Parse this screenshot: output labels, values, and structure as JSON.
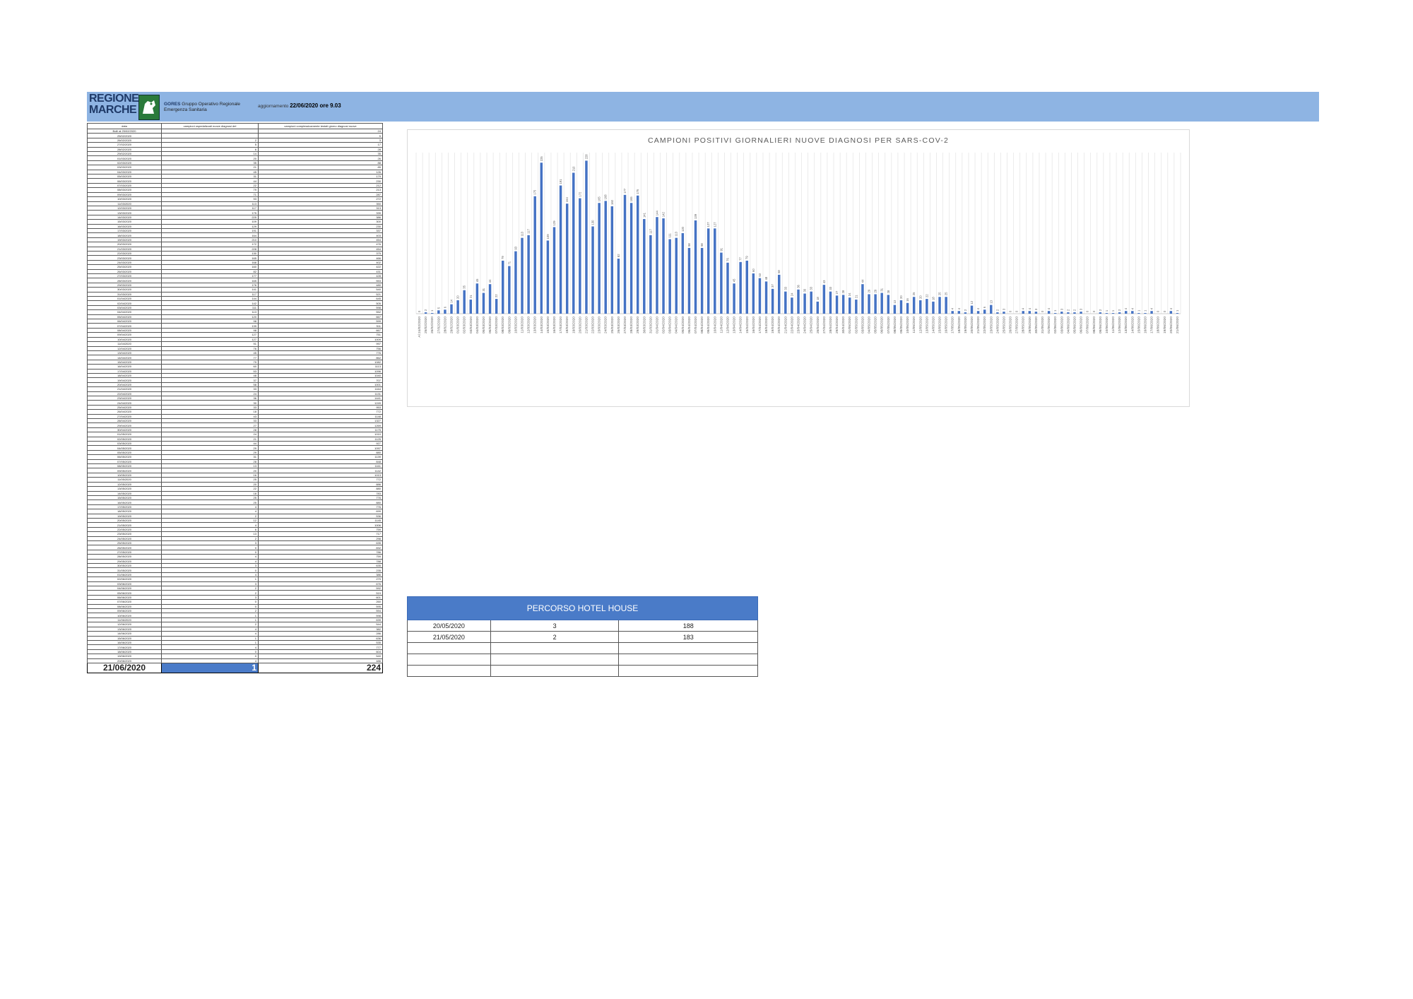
{
  "header": {
    "logo_text_1": "REGIONE",
    "logo_text_2": "MARCHE",
    "gores_title": "GORES",
    "gores_line1": "Gruppo Operativo Regionale",
    "gores_line2": "Emergenza Sanitaria",
    "update_label": "aggiornamento",
    "update_value": "22/06/2020 ore 9.03",
    "band_color": "#8eb4e3"
  },
  "table": {
    "headers": [
      "data",
      "campioni ospedalizzati nuove diagnosi del",
      "campioni complessivamente testati giorno diagnosi nuove"
    ],
    "rows": [
      [
        "Bolli al 25/02/2020",
        "",
        "24"
      ],
      [
        "25/02/2020",
        "",
        "5"
      ],
      [
        "26/02/2020",
        "2",
        "3"
      ],
      [
        "27/02/2020",
        "5",
        "17"
      ],
      [
        "28/02/2020",
        "6",
        "28"
      ],
      [
        "29/02/2020",
        "14",
        "35"
      ],
      [
        "01/03/2020",
        "20",
        "26"
      ],
      [
        "02/03/2020",
        "35",
        "88"
      ],
      [
        "03/03/2020",
        "21",
        "85"
      ],
      [
        "04/03/2020",
        "45",
        "126"
      ],
      [
        "05/03/2020",
        "31",
        "179"
      ],
      [
        "06/03/2020",
        "44",
        "230"
      ],
      [
        "07/03/2020",
        "22",
        "212"
      ],
      [
        "08/03/2020",
        "79",
        "213"
      ],
      [
        "09/03/2020",
        "71",
        "287"
      ],
      [
        "10/03/2020",
        "93",
        "272"
      ],
      [
        "11/03/2020",
        "113",
        "350"
      ],
      [
        "12/03/2020",
        "117",
        "313"
      ],
      [
        "13/03/2020",
        "175",
        "339"
      ],
      [
        "14/03/2020",
        "225",
        "386"
      ],
      [
        "15/03/2020",
        "109",
        "300"
      ],
      [
        "16/03/2020",
        "129",
        "230"
      ],
      [
        "17/03/2020",
        "191",
        "337"
      ],
      [
        "18/03/2020",
        "164",
        "403"
      ],
      [
        "19/03/2020",
        "210",
        "454"
      ],
      [
        "20/03/2020",
        "172",
        "476"
      ],
      [
        "21/03/2020",
        "228",
        "454"
      ],
      [
        "22/03/2020",
        "130",
        "375"
      ],
      [
        "23/03/2020",
        "165",
        "466"
      ],
      [
        "24/03/2020",
        "168",
        "402"
      ],
      [
        "25/03/2020",
        "160",
        "422"
      ],
      [
        "26/03/2020",
        "82",
        "431"
      ],
      [
        "27/03/2020",
        "177",
        "428"
      ],
      [
        "28/03/2020",
        "165",
        "553"
      ],
      [
        "29/03/2020",
        "176",
        "480"
      ],
      [
        "30/03/2020",
        "141",
        "540"
      ],
      [
        "31/03/2020",
        "117",
        "521"
      ],
      [
        "01/04/2020",
        "144",
        "645"
      ],
      [
        "02/04/2020",
        "142",
        "505"
      ],
      [
        "03/04/2020",
        "111",
        "598"
      ],
      [
        "04/04/2020",
        "113",
        "552"
      ],
      [
        "05/04/2020",
        "120",
        "667"
      ],
      [
        "06/04/2020",
        "98",
        "599"
      ],
      [
        "07/04/2020",
        "139",
        "511"
      ],
      [
        "08/04/2020",
        "98",
        "667"
      ],
      [
        "09/04/2020",
        "127",
        "751"
      ],
      [
        "10/04/2020",
        "127",
        "1009"
      ],
      [
        "11/04/2020",
        "91",
        "997"
      ],
      [
        "12/04/2020",
        "76",
        "756"
      ],
      [
        "13/04/2020",
        "45",
        "776"
      ],
      [
        "14/04/2020",
        "77",
        "862"
      ],
      [
        "15/04/2020",
        "79",
        "1082"
      ],
      [
        "16/04/2020",
        "60",
        "1113"
      ],
      [
        "17/04/2020",
        "53",
        "1096"
      ],
      [
        "18/04/2020",
        "48",
        "1040"
      ],
      [
        "19/04/2020",
        "37",
        "707"
      ],
      [
        "20/04/2020",
        "58",
        "1001"
      ],
      [
        "21/04/2020",
        "33",
        "1164"
      ],
      [
        "22/04/2020",
        "24",
        "1131"
      ],
      [
        "23/04/2020",
        "36",
        "1441"
      ],
      [
        "24/04/2020",
        "30",
        "1249"
      ],
      [
        "25/04/2020",
        "33",
        "953"
      ],
      [
        "26/04/2020",
        "18",
        "772"
      ],
      [
        "27/04/2020",
        "43",
        "1148"
      ],
      [
        "28/04/2020",
        "33",
        "1327"
      ],
      [
        "29/04/2020",
        "27",
        "1269"
      ],
      [
        "30/04/2020",
        "28",
        "1175"
      ],
      [
        "01/05/2020",
        "24",
        "1010"
      ],
      [
        "02/05/2020",
        "21",
        "1125"
      ],
      [
        "03/05/2020",
        "44",
        "927"
      ],
      [
        "04/05/2020",
        "29",
        "1097"
      ],
      [
        "05/05/2020",
        "29",
        "880"
      ],
      [
        "06/05/2020",
        "31",
        "1139"
      ],
      [
        "07/05/2020",
        "28",
        "848"
      ],
      [
        "08/05/2020",
        "13",
        "1161"
      ],
      [
        "09/05/2020",
        "20",
        "1142"
      ],
      [
        "10/05/2020",
        "16",
        "1013"
      ],
      [
        "11/05/2020",
        "25",
        "772"
      ],
      [
        "12/05/2020",
        "20",
        "886"
      ],
      [
        "13/05/2020",
        "22",
        "880"
      ],
      [
        "14/05/2020",
        "18",
        "783"
      ],
      [
        "15/05/2020",
        "25",
        "776"
      ],
      [
        "16/05/2020",
        "25",
        "880"
      ],
      [
        "17/05/2020",
        "4",
        "776"
      ],
      [
        "18/05/2020",
        "4",
        "699"
      ],
      [
        "19/05/2020",
        "2",
        "536"
      ],
      [
        "20/05/2020",
        "12",
        "1145"
      ],
      [
        "21/05/2020",
        "4",
        "1006"
      ],
      [
        "22/05/2020",
        "6",
        "759"
      ],
      [
        "23/05/2020",
        "13",
        "717"
      ],
      [
        "24/05/2020",
        "2",
        "298"
      ],
      [
        "25/05/2020",
        "3",
        "635"
      ],
      [
        "26/05/2020",
        "0",
        "832"
      ],
      [
        "27/05/2020",
        "0",
        "786"
      ],
      [
        "28/05/2020",
        "4",
        "759"
      ],
      [
        "29/05/2020",
        "4",
        "788"
      ],
      [
        "30/05/2020",
        "3",
        "635"
      ],
      [
        "31/05/2020",
        "0",
        "235"
      ],
      [
        "01/06/2020",
        "4",
        "386"
      ],
      [
        "02/06/2020",
        "1",
        "279"
      ],
      [
        "03/06/2020",
        "3",
        "676"
      ],
      [
        "04/06/2020",
        "2",
        "592"
      ],
      [
        "05/06/2020",
        "2",
        "519"
      ],
      [
        "06/06/2020",
        "3",
        "601"
      ],
      [
        "07/06/2020",
        "0",
        "260"
      ],
      [
        "08/06/2020",
        "0",
        "595"
      ],
      [
        "09/06/2020",
        "2",
        "594"
      ],
      [
        "10/06/2020",
        "1",
        "598"
      ],
      [
        "11/06/2020",
        "1",
        "639"
      ],
      [
        "12/06/2020",
        "2",
        "544"
      ],
      [
        "13/06/2020",
        "4",
        "382"
      ],
      [
        "14/06/2020",
        "4",
        "286"
      ],
      [
        "15/06/2020",
        "1",
        "636"
      ],
      [
        "16/06/2020",
        "1",
        "535"
      ],
      [
        "17/06/2020",
        "4",
        "777"
      ],
      [
        "18/06/2020",
        "0",
        "604"
      ],
      [
        "19/06/2020",
        "0",
        "540"
      ],
      [
        "20/06/2020",
        "4",
        "486"
      ]
    ],
    "total": {
      "date": "21/06/2020",
      "v1": "1",
      "v2": "224"
    }
  },
  "chart_data": {
    "type": "bar",
    "title": "CAMPIONI POSITIVI GIORNALIERI NUOVE DIAGNOSI PER SARS-COV-2",
    "xlabel": "",
    "ylabel": "",
    "grid": "vertical",
    "bar_color": "#4472c4",
    "categories": [
      "Al 24/02/2020",
      "25/02/2020",
      "26/02/2020",
      "27/02/2020",
      "28/02/2020",
      "29/02/2020",
      "01/03/2020",
      "02/03/2020",
      "03/03/2020",
      "04/03/2020",
      "05/03/2020",
      "06/03/2020",
      "07/03/2020",
      "08/03/2020",
      "09/03/2020",
      "10/03/2020",
      "11/03/2020",
      "12/03/2020",
      "13/03/2020",
      "14/03/2020",
      "15/03/2020",
      "16/03/2020",
      "17/03/2020",
      "18/03/2020",
      "19/03/2020",
      "20/03/2020",
      "21/03/2020",
      "22/03/2020",
      "23/03/2020",
      "24/03/2020",
      "25/03/2020",
      "26/03/2020",
      "27/03/2020",
      "28/03/2020",
      "29/03/2020",
      "30/03/2020",
      "31/03/2020",
      "01/04/2020",
      "02/04/2020",
      "03/04/2020",
      "04/04/2020",
      "05/04/2020",
      "06/04/2020",
      "07/04/2020",
      "08/04/2020",
      "09/04/2020",
      "10/04/2020",
      "11/04/2020",
      "12/04/2020",
      "13/04/2020",
      "14/04/2020",
      "15/04/2020",
      "16/04/2020",
      "17/04/2020",
      "18/04/2020",
      "19/04/2020",
      "20/04/2020",
      "21/04/2020",
      "22/04/2020",
      "23/04/2020",
      "24/04/2020",
      "25/04/2020",
      "26/04/2020",
      "27/04/2020",
      "28/04/2020",
      "29/04/2020",
      "30/04/2020",
      "01/05/2020",
      "02/05/2020",
      "03/05/2020",
      "04/05/2020",
      "05/05/2020",
      "06/05/2020",
      "07/05/2020",
      "08/05/2020",
      "09/05/2020",
      "10/05/2020",
      "11/05/2020",
      "12/05/2020",
      "13/05/2020",
      "14/05/2020",
      "15/05/2020",
      "16/05/2020",
      "17/05/2020",
      "18/05/2020",
      "19/05/2020",
      "20/05/2020",
      "21/05/2020",
      "22/05/2020",
      "23/05/2020",
      "24/05/2020",
      "25/05/2020",
      "26/05/2020",
      "27/05/2020",
      "28/05/2020",
      "29/05/2020",
      "30/05/2020",
      "31/05/2020",
      "01/06/2020",
      "02/06/2020",
      "03/06/2020",
      "04/06/2020",
      "05/06/2020",
      "06/06/2020",
      "07/06/2020",
      "08/06/2020",
      "09/06/2020",
      "10/06/2020",
      "11/06/2020",
      "12/06/2020",
      "13/06/2020",
      "14/06/2020",
      "15/06/2020",
      "16/06/2020",
      "17/06/2020",
      "18/06/2020",
      "19/06/2020",
      "20/06/2020",
      "21/06/2020"
    ],
    "values": [
      0,
      2,
      1,
      5,
      6,
      14,
      20,
      35,
      21,
      45,
      31,
      44,
      22,
      79,
      71,
      93,
      113,
      117,
      175,
      225,
      109,
      129,
      191,
      164,
      210,
      172,
      228,
      130,
      165,
      168,
      160,
      82,
      177,
      165,
      176,
      141,
      117,
      144,
      142,
      111,
      113,
      120,
      98,
      139,
      98,
      127,
      127,
      91,
      76,
      45,
      77,
      79,
      60,
      53,
      48,
      37,
      58,
      33,
      24,
      36,
      30,
      33,
      18,
      43,
      33,
      27,
      28,
      24,
      21,
      44,
      29,
      29,
      31,
      28,
      13,
      20,
      16,
      25,
      20,
      22,
      18,
      25,
      25,
      4,
      4,
      2,
      12,
      4,
      6,
      13,
      2,
      3,
      0,
      0,
      4,
      4,
      3,
      0,
      4,
      1,
      3,
      2,
      2,
      3,
      0,
      0,
      2,
      1,
      1,
      2,
      4,
      4,
      1,
      1,
      4,
      0,
      0,
      4,
      1
    ],
    "ylim": [
      0,
      240
    ]
  },
  "hotel": {
    "title": "PERCORSO HOTEL HOUSE",
    "rows": [
      [
        "20/05/2020",
        "3",
        "188"
      ],
      [
        "21/05/2020",
        "2",
        "183"
      ],
      [
        "",
        "",
        ""
      ],
      [
        "",
        "",
        ""
      ],
      [
        "",
        "",
        ""
      ]
    ],
    "header_color": "#4a7bc8"
  }
}
